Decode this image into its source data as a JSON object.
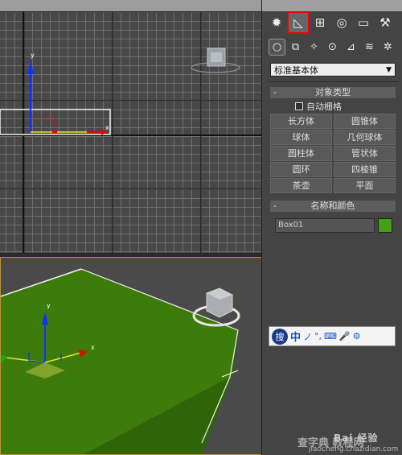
{
  "command_panel": {
    "tabs": [
      {
        "name": "display-sun",
        "glyph": "✹"
      },
      {
        "name": "create",
        "glyph": "◺",
        "active": true
      },
      {
        "name": "hierarchy",
        "glyph": "⊞"
      },
      {
        "name": "motion",
        "glyph": "◎"
      },
      {
        "name": "display",
        "glyph": "▭"
      },
      {
        "name": "utilities",
        "glyph": "⚒"
      }
    ],
    "create_subtabs": [
      {
        "name": "geometry",
        "glyph": "○",
        "active": true
      },
      {
        "name": "shapes",
        "glyph": "⧉"
      },
      {
        "name": "lights",
        "glyph": "✧"
      },
      {
        "name": "cameras",
        "glyph": "⊙"
      },
      {
        "name": "helpers",
        "glyph": "⊿"
      },
      {
        "name": "space-warps",
        "glyph": "≋"
      },
      {
        "name": "systems",
        "glyph": "✲"
      }
    ],
    "category_dropdown": "标准基本体",
    "object_type": {
      "title": "对象类型",
      "collapse": "-",
      "autogrid_label": "自动栅格",
      "buttons": [
        "长方体",
        "圆锥体",
        "球体",
        "几何球体",
        "圆柱体",
        "管状体",
        "圆环",
        "四棱锥",
        "茶壶",
        "平面"
      ]
    },
    "name_and_color": {
      "title": "名称和颜色",
      "collapse": "-",
      "name_value": "Box01",
      "color": "#45a016"
    }
  },
  "ime_toolbar": {
    "logo": "搜",
    "items": [
      "中",
      "ノ",
      "°,",
      "⌨",
      "🎤",
      "⚙"
    ]
  },
  "watermark": {
    "brand": "Bai 经验",
    "site_chars": "查字典 教程网",
    "url": "jiaocheng.chazidian.com"
  },
  "viewport_top": {
    "axis_labels": {
      "x": "x",
      "y": "y"
    }
  },
  "viewport_persp": {
    "axis_labels": {
      "x": "x",
      "y": "y"
    },
    "box_color": "#3f8a0a"
  }
}
